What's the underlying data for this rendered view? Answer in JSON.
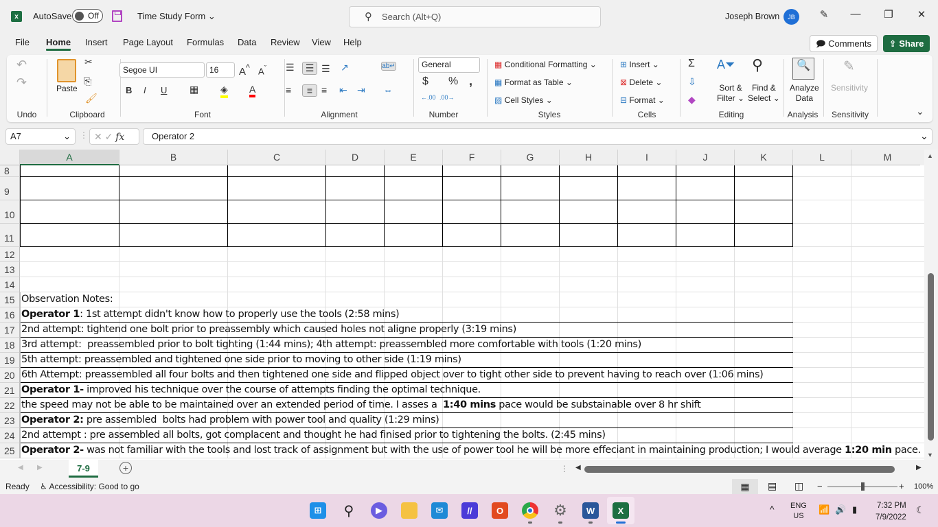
{
  "titlebar": {
    "app_icon": "excel-icon",
    "autosave_label": "AutoSave",
    "autosave_state": "Off",
    "document_title": "Time Study Form",
    "search_placeholder": "Search (Alt+Q)",
    "user_name": "Joseph Brown",
    "user_initials": "JB"
  },
  "menu": {
    "tabs": [
      "File",
      "Home",
      "Insert",
      "Page Layout",
      "Formulas",
      "Data",
      "Review",
      "View",
      "Help"
    ],
    "active": "Home",
    "comments_label": "Comments",
    "share_label": "Share"
  },
  "ribbon": {
    "groups": {
      "undo": "Undo",
      "clipboard": "Clipboard",
      "font": "Font",
      "alignment": "Alignment",
      "number": "Number",
      "styles": "Styles",
      "cells": "Cells",
      "editing": "Editing",
      "analysis": "Analysis",
      "sensitivity": "Sensitivity"
    },
    "paste_label": "Paste",
    "font_name": "Segoe UI",
    "font_size": "16",
    "number_format": "General",
    "conditional_formatting": "Conditional Formatting",
    "format_as_table": "Format as Table",
    "cell_styles": "Cell Styles",
    "insert": "Insert",
    "delete": "Delete",
    "format": "Format",
    "sort_filter": [
      "Sort &",
      "Filter"
    ],
    "find_select": [
      "Find &",
      "Select"
    ],
    "analyze_data": [
      "Analyze",
      "Data"
    ],
    "sensitivity_btn": "Sensitivity",
    "fill_color": "#ffff00",
    "font_color": "#ff0000"
  },
  "formula_bar": {
    "name_box": "A7",
    "fx": "fx",
    "content": "Operator 2"
  },
  "grid": {
    "columns": [
      "A",
      "B",
      "C",
      "D",
      "E",
      "F",
      "G",
      "H",
      "I",
      "J",
      "K",
      "L",
      "M"
    ],
    "selected_column": "A",
    "rows": [
      "8",
      "9",
      "10",
      "11",
      "12",
      "13",
      "14",
      "15",
      "16",
      "17",
      "18",
      "19",
      "20",
      "21",
      "22",
      "23",
      "24",
      "25"
    ],
    "notes": [
      {
        "row": "15",
        "parts": [
          {
            "t": "Observation Notes:",
            "b": false
          }
        ]
      },
      {
        "row": "16",
        "parts": [
          {
            "t": "Operator 1",
            "b": true
          },
          {
            "t": ": 1st attempt didn't know how to properly use the tools (2:58 mins)",
            "b": false
          }
        ]
      },
      {
        "row": "17",
        "parts": [
          {
            "t": "2nd attempt: tightend one bolt prior to preassembly which caused holes not aligne properly (3:19 mins)",
            "b": false
          }
        ]
      },
      {
        "row": "18",
        "parts": [
          {
            "t": "3rd attempt:  preassembled prior to bolt tighting (1:44 mins); 4th attempt: preassembled more comfortable with tools (1:20 mins)",
            "b": false
          }
        ]
      },
      {
        "row": "19",
        "parts": [
          {
            "t": "5th attempt: preassembled and tightened one side prior to moving to other side (1:19 mins)",
            "b": false
          }
        ]
      },
      {
        "row": "20",
        "parts": [
          {
            "t": "6th Attempt: preassembled all four bolts and then tightened one side and flipped object over to tight other side to prevent having to reach over (1:06 mins)",
            "b": false
          }
        ]
      },
      {
        "row": "21",
        "parts": [
          {
            "t": "Operator 1-",
            "b": true
          },
          {
            "t": " improved his technique over the course of attempts finding the optimal technique.",
            "b": false
          }
        ]
      },
      {
        "row": "22",
        "parts": [
          {
            "t": "the speed may not be able to be maintained over an extended period of time. I asses a  ",
            "b": false
          },
          {
            "t": "1:40 mins",
            "b": true
          },
          {
            "t": " pace would be substainable over 8 hr shift",
            "b": false
          }
        ]
      },
      {
        "row": "23",
        "parts": [
          {
            "t": "Operator 2:",
            "b": true
          },
          {
            "t": " pre assembled  bolts had problem with power tool and quality (1:29 mins)",
            "b": false
          }
        ]
      },
      {
        "row": "24",
        "parts": [
          {
            "t": "2nd attempt : pre assembled all bolts, got complacent and thought he had finised prior to tightening the bolts. (2:45 mins)",
            "b": false
          }
        ]
      },
      {
        "row": "25",
        "parts": [
          {
            "t": "Operator 2-",
            "b": true
          },
          {
            "t": " was not familiar with the tools and lost track of assignment but with the use of power tool he will be more effeciant in maintaining production; I would average ",
            "b": false
          },
          {
            "t": "1:20 min",
            "b": true
          },
          {
            "t": " pace.",
            "b": false
          }
        ]
      }
    ]
  },
  "sheets": {
    "tabs": [
      "7-9"
    ],
    "active": "7-9"
  },
  "status": {
    "ready": "Ready",
    "accessibility": "Accessibility: Good to go",
    "zoom": "100%",
    "zoom_fraction": 0.5
  },
  "taskbar": {
    "apps": [
      "start",
      "search",
      "teams-chat",
      "file-explorer",
      "mail",
      "app-ma",
      "office",
      "chrome",
      "settings",
      "word",
      "excel"
    ],
    "language": [
      "ENG",
      "US"
    ],
    "time": "7:32 PM",
    "date": "7/9/2022"
  }
}
